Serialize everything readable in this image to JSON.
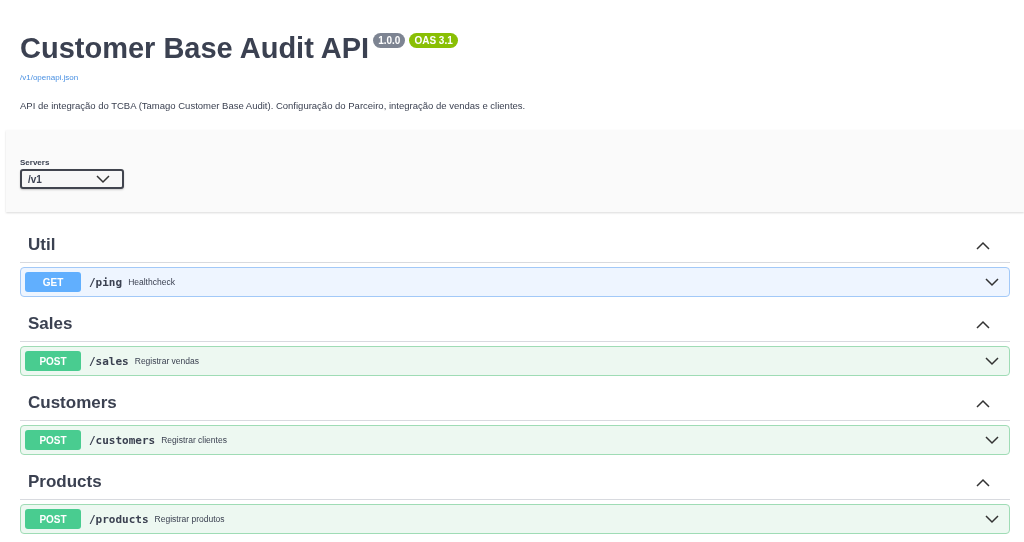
{
  "info": {
    "title": "Customer Base Audit API",
    "version": "1.0.0",
    "oas": "OAS 3.1",
    "spec_link": "/v1/openapi.json",
    "description": "API de integração do TCBA (Tamago Customer Base Audit). Configuração do Parceiro, integração de vendas e clientes."
  },
  "servers": {
    "label": "Servers",
    "value": "/v1"
  },
  "tags": [
    {
      "name": "Util",
      "expanded": true,
      "operations": [
        {
          "method": "GET",
          "path": "/ping",
          "summary": "Healthcheck",
          "expanded": false
        }
      ]
    },
    {
      "name": "Sales",
      "expanded": true,
      "operations": [
        {
          "method": "POST",
          "path": "/sales",
          "summary": "Registrar vendas",
          "expanded": false
        }
      ]
    },
    {
      "name": "Customers",
      "expanded": true,
      "operations": [
        {
          "method": "POST",
          "path": "/customers",
          "summary": "Registrar clientes",
          "expanded": false
        }
      ]
    },
    {
      "name": "Products",
      "expanded": true,
      "operations": [
        {
          "method": "POST",
          "path": "/products",
          "summary": "Registrar produtos",
          "expanded": false
        }
      ]
    }
  ]
}
